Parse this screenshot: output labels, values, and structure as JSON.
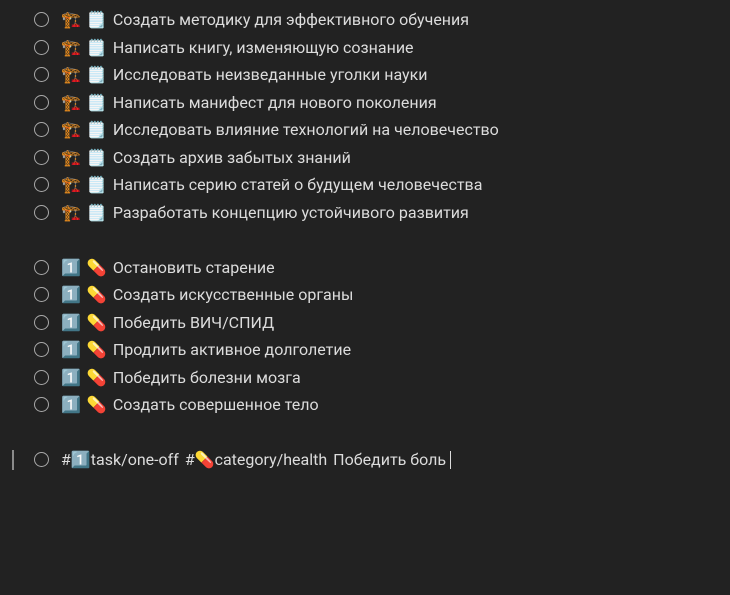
{
  "icons": {
    "crane": "🏗️",
    "notepad": "🗒️",
    "one": "1️⃣",
    "pill": "💊"
  },
  "group1": {
    "type_icon1": "crane",
    "type_icon2": "notepad",
    "items": [
      {
        "text": "Создать методику для эффективного обучения"
      },
      {
        "text": "Написать книгу, изменяющую сознание"
      },
      {
        "text": "Исследовать неизведанные уголки науки"
      },
      {
        "text": "Написать манифест для нового поколения"
      },
      {
        "text": "Исследовать влияние технологий на человечество"
      },
      {
        "text": "Создать архив забытых знаний"
      },
      {
        "text": "Написать серию статей о будущем человечества"
      },
      {
        "text": "Разработать концепцию устойчивого развития"
      }
    ]
  },
  "group2": {
    "type_icon1": "one",
    "type_icon2": "pill",
    "items": [
      {
        "text": "Остановить старение"
      },
      {
        "text": "Создать искусственные органы"
      },
      {
        "text": "Победить ВИЧ/СПИД"
      },
      {
        "text": "Продлить активное долголетие"
      },
      {
        "text": "Победить болезни мозга"
      },
      {
        "text": "Создать совершенное тело"
      }
    ]
  },
  "input": {
    "tag1_prefix": "#",
    "tag1_icon": "one",
    "tag1_text": "task/one-off",
    "tag2_prefix": "#",
    "tag2_icon": "pill",
    "tag2_text": "category/health",
    "text": "Победить боль"
  }
}
